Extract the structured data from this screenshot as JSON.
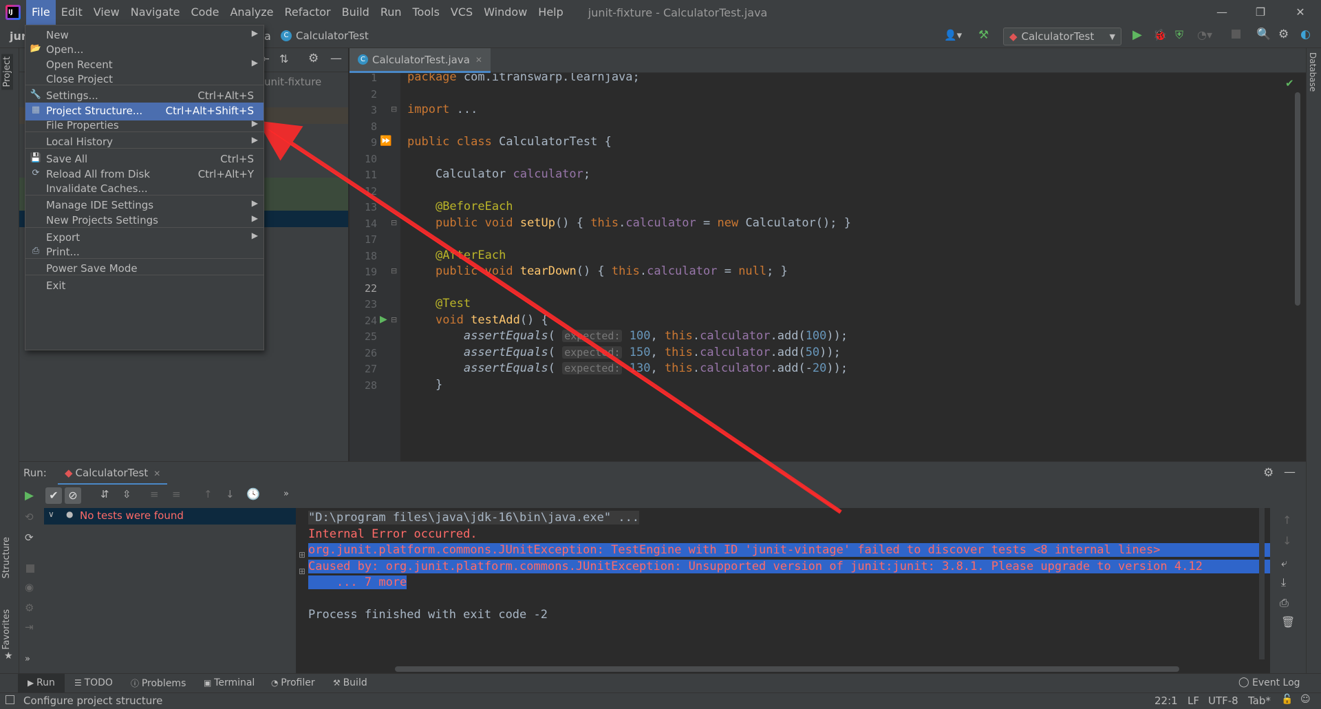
{
  "window": {
    "title": "junit-fixture - CalculatorTest.java",
    "minimize": "—",
    "restore": "❐",
    "close": "✕"
  },
  "menubar": [
    "File",
    "Edit",
    "View",
    "Navigate",
    "Code",
    "Analyze",
    "Refactor",
    "Build",
    "Run",
    "Tools",
    "VCS",
    "Window",
    "Help"
  ],
  "navbar": {
    "project_short": "jur",
    "breadcrumb_suffix": "a",
    "breadcrumb_file": "CalculatorTest",
    "run_config": "CalculatorTest"
  },
  "project_panel": {
    "tree_root": "unit-fixture"
  },
  "file_menu": {
    "items": [
      {
        "label": "New",
        "shortcut": "",
        "submenu": true,
        "icon": ""
      },
      {
        "label": "Open...",
        "shortcut": "",
        "submenu": false,
        "icon": "folder-icon"
      },
      {
        "label": "Open Recent",
        "shortcut": "",
        "submenu": true,
        "icon": ""
      },
      {
        "label": "Close Project",
        "shortcut": "",
        "submenu": false,
        "icon": ""
      },
      {
        "label": "Settings...",
        "shortcut": "Ctrl+Alt+S",
        "submenu": false,
        "icon": "wrench-icon"
      },
      {
        "label": "Project Structure...",
        "shortcut": "Ctrl+Alt+Shift+S",
        "submenu": false,
        "icon": "project-structure-icon",
        "highlighted": true
      },
      {
        "label": "File Properties",
        "shortcut": "",
        "submenu": true,
        "icon": ""
      },
      {
        "label": "Local History",
        "shortcut": "",
        "submenu": true,
        "icon": ""
      },
      {
        "label": "Save All",
        "shortcut": "Ctrl+S",
        "submenu": false,
        "icon": "save-icon"
      },
      {
        "label": "Reload All from Disk",
        "shortcut": "Ctrl+Alt+Y",
        "submenu": false,
        "icon": "reload-icon"
      },
      {
        "label": "Invalidate Caches...",
        "shortcut": "",
        "submenu": false,
        "icon": ""
      },
      {
        "label": "Manage IDE Settings",
        "shortcut": "",
        "submenu": true,
        "icon": ""
      },
      {
        "label": "New Projects Settings",
        "shortcut": "",
        "submenu": true,
        "icon": ""
      },
      {
        "label": "Export",
        "shortcut": "",
        "submenu": true,
        "icon": ""
      },
      {
        "label": "Print...",
        "shortcut": "",
        "submenu": false,
        "icon": "print-icon"
      },
      {
        "label": "Power Save Mode",
        "shortcut": "",
        "submenu": false,
        "icon": ""
      },
      {
        "label": "Exit",
        "shortcut": "",
        "submenu": false,
        "icon": ""
      }
    ]
  },
  "editor": {
    "tab": "CalculatorTest.java",
    "lines": [
      {
        "n": "1",
        "code": "package com.itranswarp.learnjava;"
      },
      {
        "n": "2",
        "code": ""
      },
      {
        "n": "3",
        "code": "import ..."
      },
      {
        "n": "8",
        "code": ""
      },
      {
        "n": "9",
        "code": "public class CalculatorTest {"
      },
      {
        "n": "10",
        "code": ""
      },
      {
        "n": "11",
        "code": "    Calculator calculator;"
      },
      {
        "n": "12",
        "code": ""
      },
      {
        "n": "13",
        "code": "    @BeforeEach"
      },
      {
        "n": "14",
        "code": "    public void setUp() { this.calculator = new Calculator(); }"
      },
      {
        "n": "17",
        "code": ""
      },
      {
        "n": "18",
        "code": "    @AfterEach"
      },
      {
        "n": "19",
        "code": "    public void tearDown() { this.calculator = null; }"
      },
      {
        "n": "22",
        "code": ""
      },
      {
        "n": "23",
        "code": "    @Test"
      },
      {
        "n": "24",
        "code": "    void testAdd() {"
      },
      {
        "n": "25",
        "code": "        assertEquals( expected: 100, this.calculator.add(100));"
      },
      {
        "n": "26",
        "code": "        assertEquals( expected: 150, this.calculator.add(50));"
      },
      {
        "n": "27",
        "code": "        assertEquals( expected: 130, this.calculator.add(-20));"
      },
      {
        "n": "28",
        "code": "    }"
      }
    ]
  },
  "run_panel": {
    "label": "Run:",
    "tab": "CalculatorTest",
    "tree_status": "No tests were found",
    "console": [
      "\"D:\\program files\\java\\jdk-16\\bin\\java.exe\" ...",
      "Internal Error occurred.",
      "org.junit.platform.commons.JUnitException: TestEngine with ID 'junit-vintage' failed to discover tests <8 internal lines>",
      "Caused by: org.junit.platform.commons.JUnitException: Unsupported version of junit:junit: 3.8.1. Please upgrade to version 4.12",
      "    ... 7 more",
      "",
      "Process finished with exit code -2"
    ]
  },
  "left_stripe": {
    "project": "Project",
    "structure": "Structure",
    "favorites": "Favorites"
  },
  "right_stripe": {
    "database": "Database"
  },
  "bottom_tabs": [
    "Run",
    "TODO",
    "Problems",
    "Terminal",
    "Profiler",
    "Build"
  ],
  "event_log": "Event Log",
  "status": {
    "message": "Configure project structure",
    "position": "22:1",
    "line_sep": "LF",
    "encoding": "UTF-8",
    "indent": "Tab*"
  },
  "colors": {
    "accent": "#4b6eaf",
    "error": "#ff6b68",
    "arrow": "#ff2a2a"
  }
}
